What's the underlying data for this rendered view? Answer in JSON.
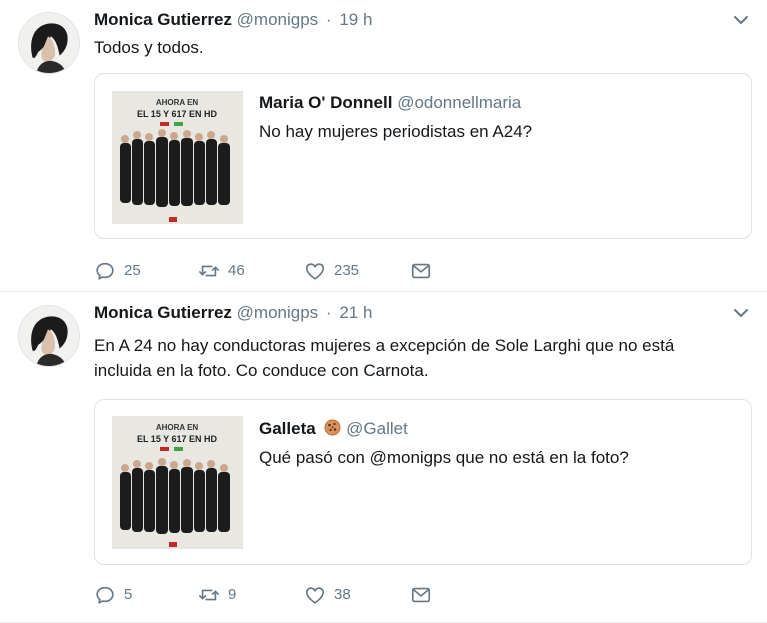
{
  "tweets": [
    {
      "author": "Monica Gutierrez",
      "handle": "@monigps",
      "separator": "·",
      "time": "19 h",
      "text": "Todos y todos.",
      "quote": {
        "author": "Maria O' Donnell",
        "handle": "@odonnellmaria",
        "has_emoji": false,
        "text": "No hay mujeres periodistas en A24?",
        "image_caption": [
          "AHORA EN",
          "EL 15 Y 617 EN HD"
        ]
      },
      "actions": {
        "replies": "25",
        "retweets": "46",
        "likes": "235"
      }
    },
    {
      "author": "Monica Gutierrez",
      "handle": "@monigps",
      "separator": "·",
      "time": "21 h",
      "text_lines": [
        "En A 24 no hay conductoras mujeres a excepción de Sole Larghi que no está",
        "incluida en la foto. Co conduce con Carnota."
      ],
      "quote": {
        "author": "Galleta",
        "handle": "@Gallet",
        "has_emoji": true,
        "emoji_icon": "cookie-icon",
        "text": "Qué pasó con @monigps que no está en la foto?",
        "image_caption": [
          "AHORA EN",
          "EL 15 Y 617 EN HD"
        ]
      },
      "actions": {
        "replies": "5",
        "retweets": "9",
        "likes": "38"
      }
    }
  ],
  "colors": {
    "secondary_text": "#657786",
    "border": "#dde3e8",
    "primary_text": "#14171a"
  },
  "icons": [
    "reply-icon",
    "retweet-icon",
    "like-icon",
    "message-icon",
    "chevron-down-icon"
  ]
}
